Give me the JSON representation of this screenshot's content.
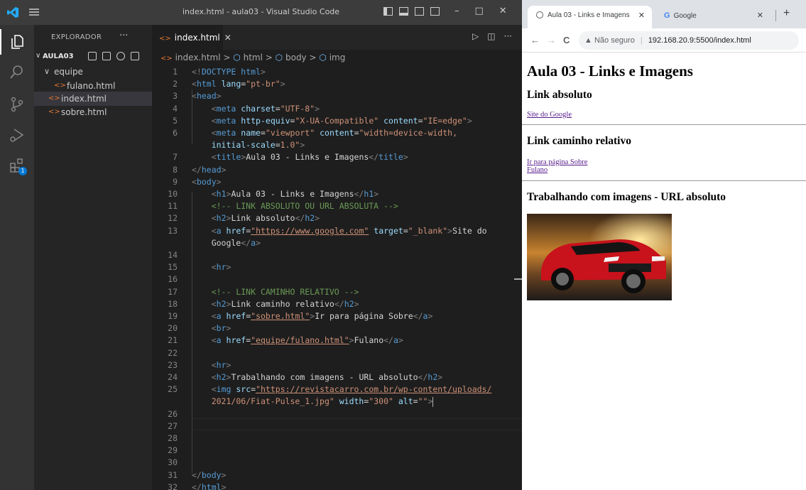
{
  "vscode": {
    "window_title": "index.html - aula03 - Visual Studio Code",
    "win_controls": {
      "minimize": "–",
      "maximize": "□",
      "close": "✕"
    },
    "explorer": {
      "header": "EXPLORADOR",
      "more": "···",
      "project": "AULA03",
      "project_chevron": "∨",
      "items": [
        {
          "label": "equipe",
          "type": "folder",
          "chevron": "∨"
        },
        {
          "label": "fulano.html",
          "type": "file"
        },
        {
          "label": "index.html",
          "type": "file",
          "active": true
        },
        {
          "label": "sobre.html",
          "type": "file"
        }
      ]
    },
    "activity_badge": "1",
    "tab": {
      "label": "index.html",
      "close": "✕"
    },
    "breadcrumb": [
      "index.html",
      "html",
      "body",
      "img"
    ],
    "breadcrumb_sep": ">",
    "file_icon": "<>",
    "tab_actions": {
      "run": "▷",
      "split": "◫",
      "more": "···"
    },
    "code_lines": [
      {
        "n": "1",
        "text": "<!DOCTYPE html>"
      },
      {
        "n": "2",
        "text": "<html lang=\"pt-br\">"
      },
      {
        "n": "3",
        "text": "<head>"
      },
      {
        "n": "4",
        "text": "    <meta charset=\"UTF-8\">"
      },
      {
        "n": "5",
        "text": "    <meta http-equiv=\"X-UA-Compatible\" content=\"IE=edge\">"
      },
      {
        "n": "6",
        "text": "    <meta name=\"viewport\" content=\"width=device-width,"
      },
      {
        "n": "",
        "text": "    initial-scale=1.0\">"
      },
      {
        "n": "7",
        "text": "    <title>Aula 03 - Links e Imagens</title>"
      },
      {
        "n": "8",
        "text": "</head>"
      },
      {
        "n": "9",
        "text": "<body>"
      },
      {
        "n": "10",
        "text": "    <h1>Aula 03 - Links e Imagens</h1>"
      },
      {
        "n": "11",
        "text": "    <!-- LINK ABSOLUTO OU URL ABSOLUTA -->"
      },
      {
        "n": "12",
        "text": "    <h2>Link absoluto</h2>"
      },
      {
        "n": "13",
        "text": "    <a href=\"https://www.google.com\" target=\"_blank\">Site do"
      },
      {
        "n": "",
        "text": "    Google</a>"
      },
      {
        "n": "14",
        "text": ""
      },
      {
        "n": "15",
        "text": "    <hr>"
      },
      {
        "n": "16",
        "text": ""
      },
      {
        "n": "17",
        "text": "    <!-- LINK CAMINHO RELATIVO -->"
      },
      {
        "n": "18",
        "text": "    <h2>Link caminho relativo</h2>"
      },
      {
        "n": "19",
        "text": "    <a href=\"sobre.html\">Ir para página Sobre</a>"
      },
      {
        "n": "20",
        "text": "    <br>"
      },
      {
        "n": "21",
        "text": "    <a href=\"equipe/fulano.html\">Fulano</a>"
      },
      {
        "n": "22",
        "text": ""
      },
      {
        "n": "23",
        "text": "    <hr>"
      },
      {
        "n": "24",
        "text": "    <h2>Trabalhando com imagens - URL absoluto</h2>"
      },
      {
        "n": "25",
        "text": "    <img src=\"https://revistacarro.com.br/wp-content/uploads/"
      },
      {
        "n": "",
        "text": "    2021/06/Fiat-Pulse_1.jpg\" width=\"300\" alt=\"\">"
      },
      {
        "n": "26",
        "text": ""
      },
      {
        "n": "27",
        "text": ""
      },
      {
        "n": "28",
        "text": ""
      },
      {
        "n": "29",
        "text": ""
      },
      {
        "n": "30",
        "text": ""
      },
      {
        "n": "31",
        "text": "</body>"
      },
      {
        "n": "32",
        "text": "</html>"
      }
    ]
  },
  "browser": {
    "tabs": [
      {
        "label": "Aula 03 - Links e Imagens",
        "close": "✕",
        "active": true
      },
      {
        "label": "Google",
        "icon": "G",
        "close": "✕"
      }
    ],
    "new_tab": "+",
    "nav": {
      "back": "←",
      "forward": "→",
      "reload": "C"
    },
    "address": {
      "warning": "▲",
      "security": "Não seguro",
      "separator": "|",
      "url": "192.168.20.9:5500/index.html"
    },
    "page": {
      "h1": "Aula 03 - Links e Imagens",
      "h2_abs": "Link absoluto",
      "link_google": "Site do Google",
      "h2_rel": "Link caminho relativo",
      "link_sobre": "Ir para página Sobre",
      "link_fulano": "Fulano",
      "h2_img": "Trabalhando com imagens - URL absoluto"
    }
  },
  "colors": {
    "vscode_bg": "#1e1e1e",
    "tag": "#569cd6",
    "attr": "#9cdcfe",
    "string": "#ce9178",
    "comment": "#6a9955",
    "link": "#551a8b"
  }
}
